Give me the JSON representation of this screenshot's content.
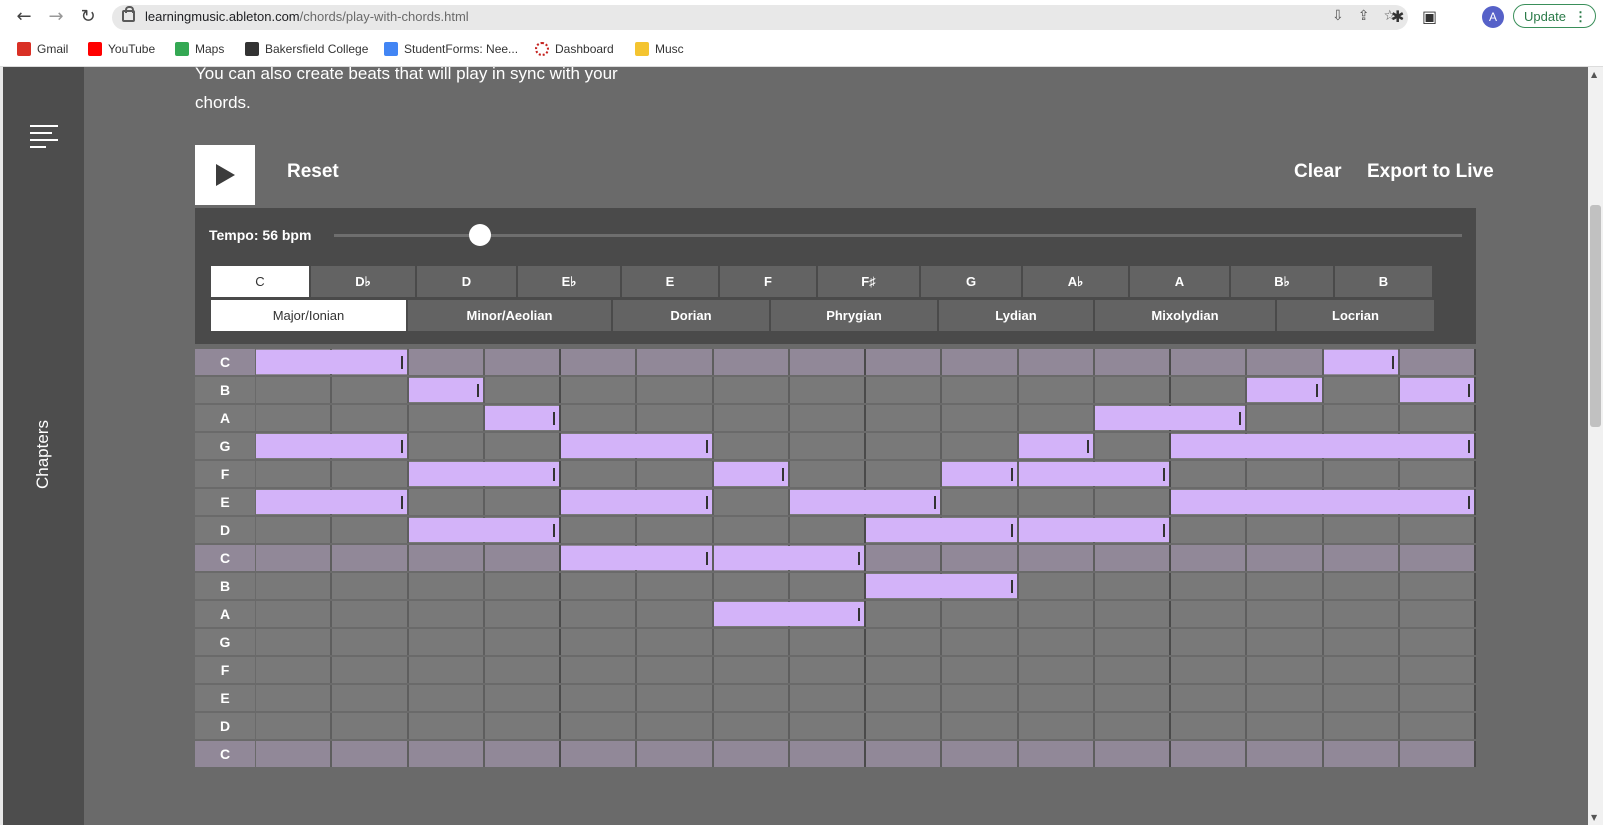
{
  "browser": {
    "url_host": "learningmusic.ableton.com",
    "url_path": "/chords/play-with-chords.html",
    "avatar_initial": "A",
    "update_label": "Update",
    "update_menu": "⋮",
    "icons": [
      "back-icon",
      "forward-icon",
      "reload-icon",
      "install-icon",
      "share-icon",
      "star-icon",
      "extensions-icon",
      "side-panel-icon"
    ]
  },
  "bookmarks": [
    {
      "label": "Gmail",
      "color": "#d93025"
    },
    {
      "label": "YouTube",
      "color": "#ff0000"
    },
    {
      "label": "Maps",
      "color": "#34a853"
    },
    {
      "label": "Bakersfield College",
      "color": "#333333"
    },
    {
      "label": "StudentForms: Nee...",
      "color": "#4285f4"
    },
    {
      "label": "Dashboard",
      "color": "#c5221f"
    },
    {
      "label": "Musc",
      "color": "#f4c430"
    }
  ],
  "sidebar": {
    "label": "Chapters"
  },
  "intro_text": "You can also create beats that will play in sync with your chords.",
  "controls": {
    "reset": "Reset",
    "clear": "Clear",
    "export": "Export to Live"
  },
  "tempo": {
    "label": "Tempo: 56 bpm",
    "value_bpm": 56,
    "slider_fraction": 0.13
  },
  "keys": [
    "C",
    "D♭",
    "D",
    "E♭",
    "E",
    "F",
    "F♯",
    "G",
    "A♭",
    "A",
    "B♭",
    "B"
  ],
  "active_key": "C",
  "modes": [
    "Major/Ionian",
    "Minor/Aeolian",
    "Dorian",
    "Phrygian",
    "Lydian",
    "Mixolydian",
    "Locrian"
  ],
  "active_mode": "Major/Ionian",
  "piano_roll": {
    "rows": [
      "C",
      "B",
      "A",
      "G",
      "F",
      "E",
      "D",
      "C",
      "B",
      "A",
      "G",
      "F",
      "E",
      "D",
      "C"
    ],
    "steps": 16,
    "notes": [
      {
        "row": 0,
        "start": 0,
        "length": 2
      },
      {
        "row": 0,
        "start": 14,
        "length": 1
      },
      {
        "row": 1,
        "start": 2,
        "length": 1
      },
      {
        "row": 1,
        "start": 13,
        "length": 1
      },
      {
        "row": 1,
        "start": 15,
        "length": 1
      },
      {
        "row": 2,
        "start": 3,
        "length": 1
      },
      {
        "row": 2,
        "start": 11,
        "length": 2
      },
      {
        "row": 3,
        "start": 0,
        "length": 2
      },
      {
        "row": 3,
        "start": 4,
        "length": 2
      },
      {
        "row": 3,
        "start": 10,
        "length": 1
      },
      {
        "row": 3,
        "start": 12,
        "length": 4
      },
      {
        "row": 4,
        "start": 2,
        "length": 2
      },
      {
        "row": 4,
        "start": 6,
        "length": 1
      },
      {
        "row": 4,
        "start": 9,
        "length": 1
      },
      {
        "row": 4,
        "start": 10,
        "length": 2
      },
      {
        "row": 5,
        "start": 0,
        "length": 2
      },
      {
        "row": 5,
        "start": 4,
        "length": 2
      },
      {
        "row": 5,
        "start": 7,
        "length": 2
      },
      {
        "row": 5,
        "start": 12,
        "length": 4
      },
      {
        "row": 6,
        "start": 2,
        "length": 2
      },
      {
        "row": 6,
        "start": 8,
        "length": 2
      },
      {
        "row": 6,
        "start": 10,
        "length": 2
      },
      {
        "row": 7,
        "start": 4,
        "length": 2
      },
      {
        "row": 7,
        "start": 6,
        "length": 2
      },
      {
        "row": 8,
        "start": 8,
        "length": 2
      },
      {
        "row": 9,
        "start": 6,
        "length": 2
      }
    ],
    "colors": {
      "note": "#d3b3f9",
      "cell": "#797979",
      "c_row_cell": "#918898"
    }
  }
}
